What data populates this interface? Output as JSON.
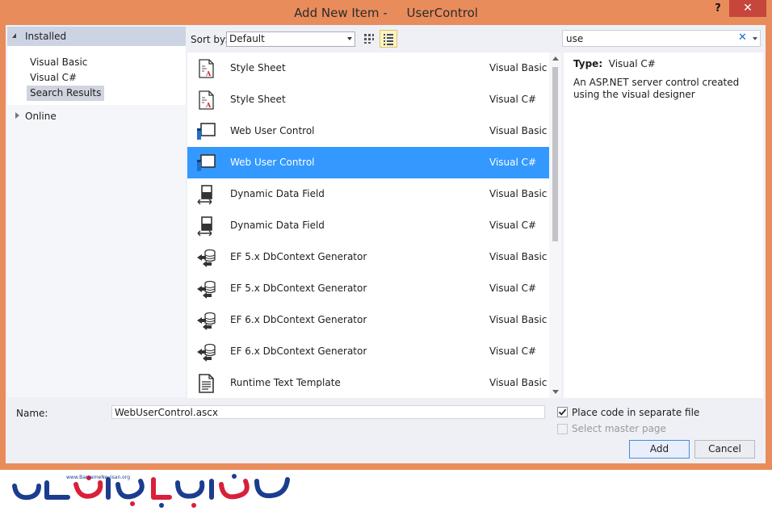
{
  "window": {
    "title": "Add New Item -     UserControl",
    "help_label": "?",
    "close_label": "✕"
  },
  "tree": {
    "installed_label": "Installed",
    "items": [
      {
        "label": "Visual Basic",
        "selected": false
      },
      {
        "label": "Visual C#",
        "selected": false
      },
      {
        "label": "Search Results",
        "selected": true
      }
    ],
    "online_label": "Online"
  },
  "toolbar": {
    "sort_label": "Sort by:",
    "sort_value": "Default",
    "search_value": "use",
    "search_clear_icon": "close-icon"
  },
  "templates": [
    {
      "name": "Style Sheet",
      "lang": "Visual Basic",
      "icon": "stylesheet-icon",
      "selected": false
    },
    {
      "name": "Style Sheet",
      "lang": "Visual C#",
      "icon": "stylesheet-icon",
      "selected": false
    },
    {
      "name": "Web User Control",
      "lang": "Visual Basic",
      "icon": "user-control-icon",
      "selected": false
    },
    {
      "name": "Web User Control",
      "lang": "Visual C#",
      "icon": "user-control-icon",
      "selected": true
    },
    {
      "name": "Dynamic Data Field",
      "lang": "Visual Basic",
      "icon": "dynamic-data-field-icon",
      "selected": false
    },
    {
      "name": "Dynamic Data Field",
      "lang": "Visual C#",
      "icon": "dynamic-data-field-icon",
      "selected": false
    },
    {
      "name": "EF 5.x DbContext Generator",
      "lang": "Visual Basic",
      "icon": "dbcontext-generator-icon",
      "selected": false
    },
    {
      "name": "EF 5.x DbContext Generator",
      "lang": "Visual C#",
      "icon": "dbcontext-generator-icon",
      "selected": false
    },
    {
      "name": "EF 6.x DbContext Generator",
      "lang": "Visual Basic",
      "icon": "dbcontext-generator-icon",
      "selected": false
    },
    {
      "name": "EF 6.x DbContext Generator",
      "lang": "Visual C#",
      "icon": "dbcontext-generator-icon",
      "selected": false
    },
    {
      "name": "Runtime Text Template",
      "lang": "Visual Basic",
      "icon": "text-template-icon",
      "selected": false
    }
  ],
  "details": {
    "type_label": "Type:",
    "type_value": "Visual C#",
    "description": "An ASP.NET server control created using the visual designer"
  },
  "bottom": {
    "name_label": "Name:",
    "name_value": "WebUserControl.ascx",
    "separate_file_label": "Place code in separate file",
    "separate_file_checked": true,
    "master_page_label": "Select master page",
    "master_page_checked": false,
    "add_label": "Add",
    "cancel_label": "Cancel"
  },
  "watermark": {
    "text": "www.BarnameNevisan.org",
    "colors": {
      "blue": "#1b3c8f",
      "red": "#d8203a"
    }
  },
  "colors": {
    "title_bar": "#e98c5c",
    "close_button": "#c7463c",
    "selection": "#3399ff"
  }
}
